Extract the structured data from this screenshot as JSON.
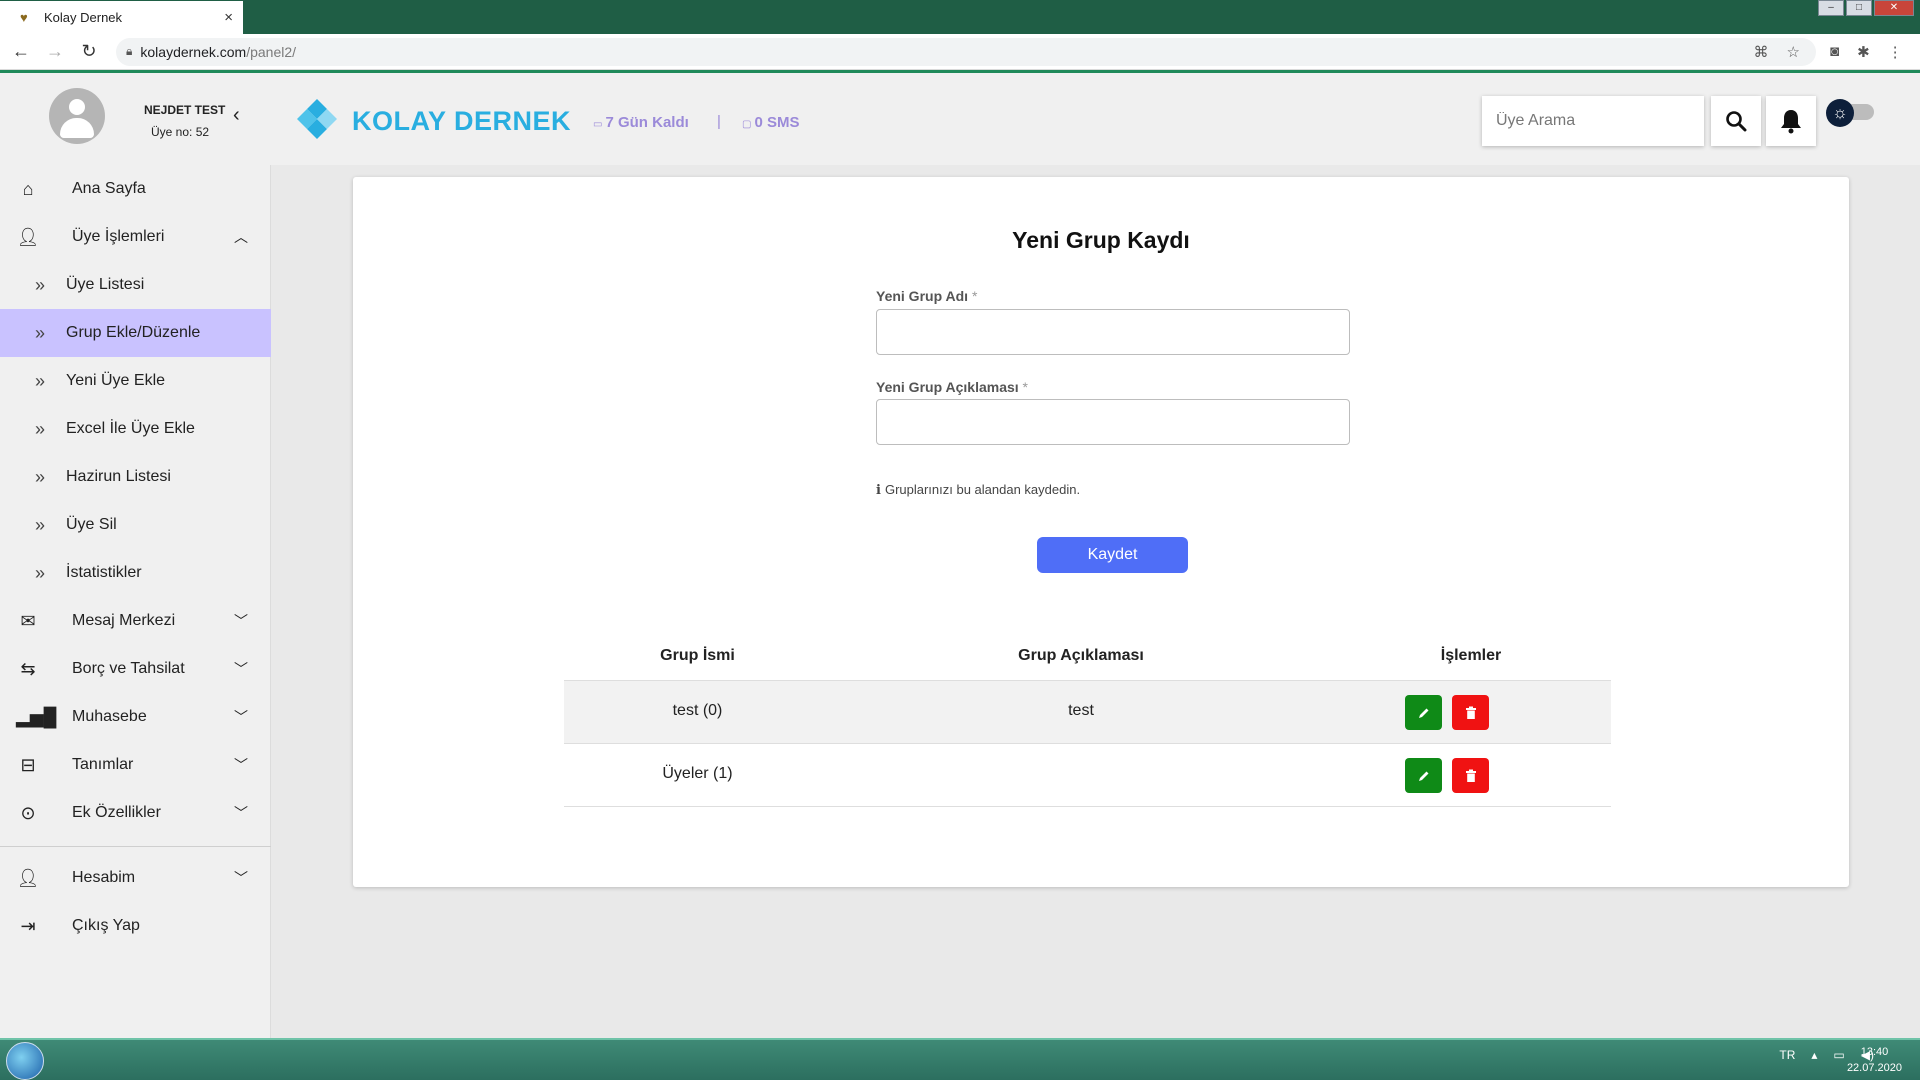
{
  "browser": {
    "tab_title": "Kolay Dernek",
    "tab_close": "×",
    "url_host": "kolaydernek.com",
    "url_path": "/panel2/"
  },
  "header": {
    "user_name": "NEJDET TEST",
    "user_no": "Üye no: 52",
    "brand": "KOLAY DERNEK",
    "days_left": "7 Gün Kaldı",
    "separator": "|",
    "sms": "0 SMS",
    "search_placeholder": "Üye Arama"
  },
  "sidebar": {
    "items": [
      {
        "label": "Ana Sayfa",
        "icon": "home-icon"
      },
      {
        "label": "Üye İşlemleri",
        "icon": "person-icon"
      },
      {
        "label": "Üye Listesi"
      },
      {
        "label": "Grup Ekle/Düzenle"
      },
      {
        "label": "Yeni Üye Ekle"
      },
      {
        "label": "Excel İle Üye Ekle"
      },
      {
        "label": "Hazirun Listesi"
      },
      {
        "label": "Üye Sil"
      },
      {
        "label": "İstatistikler"
      },
      {
        "label": "Mesaj Merkezi",
        "icon": "mail-icon"
      },
      {
        "label": "Borç ve Tahsilat",
        "icon": "transfer-icon"
      },
      {
        "label": "Muhasebe",
        "icon": "bar-chart-icon"
      },
      {
        "label": "Tanımlar",
        "icon": "briefcase-icon"
      },
      {
        "label": "Ek Özellikler",
        "icon": "more-icon"
      },
      {
        "label": "Hesabim",
        "icon": "person-icon"
      },
      {
        "label": "Çıkış Yap",
        "icon": "logout-icon"
      }
    ],
    "active_item": "Grup Ekle/Düzenle",
    "accent": "#c9c2ff"
  },
  "form": {
    "title": "Yeni Grup Kaydı",
    "group_name_label": "Yeni Grup Adı",
    "group_desc_label": "Yeni Grup Açıklaması",
    "required_mark": "*",
    "group_name_value": "",
    "group_desc_value": "",
    "hint_icon": "i",
    "hint": "Gruplarınızı bu alandan kaydedin.",
    "save_label": "Kaydet",
    "save_color": "#4f6ef7"
  },
  "table": {
    "headers": [
      "Grup İsmi",
      "Grup Açıklaması",
      "İşlemler"
    ],
    "rows": [
      {
        "name": "test (0)",
        "description": "test"
      },
      {
        "name": "Üyeler (1)",
        "description": ""
      }
    ],
    "edit_color": "#0f8a17",
    "delete_color": "#f01212"
  },
  "taskbar": {
    "lang": "TR",
    "time": "13:40",
    "date": "22.07.2020"
  }
}
